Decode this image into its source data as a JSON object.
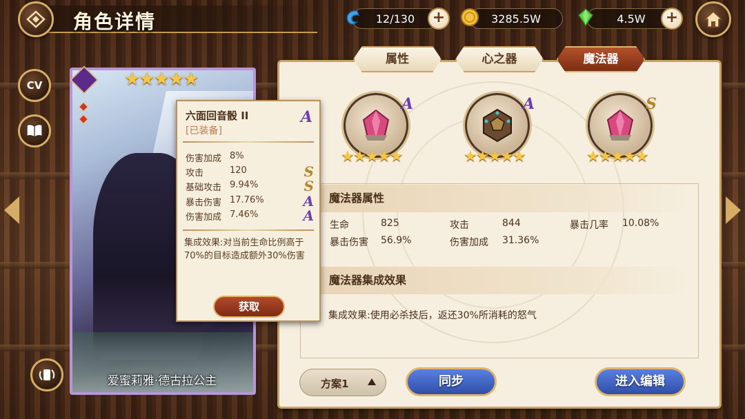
{
  "header": {
    "title": "角色详情",
    "resources": [
      {
        "name": "stamina",
        "icon": "shrimp-icon",
        "value": "12/130"
      },
      {
        "name": "gold",
        "icon": "gold-coin-icon",
        "value": "3285.5W"
      },
      {
        "name": "gems",
        "icon": "green-crystal-icon",
        "value": "4.5W"
      }
    ]
  },
  "side_buttons": {
    "cv": "CV"
  },
  "card": {
    "name": "爱蜜莉雅·德古拉公主",
    "stars": "★★★★★",
    "star_count": 5
  },
  "tooltip": {
    "item_name": "六面回音骰 II",
    "grade": "A",
    "status": "[已装备]",
    "stats": [
      {
        "label": "伤害加成",
        "value": "8%",
        "grade": ""
      },
      {
        "label": "攻击",
        "value": "120",
        "grade": "S"
      },
      {
        "label": "基础攻击",
        "value": "9.94%",
        "grade": "S"
      },
      {
        "label": "暴击伤害",
        "value": "17.76%",
        "grade": "A"
      },
      {
        "label": "伤害加成",
        "value": "7.46%",
        "grade": "A"
      }
    ],
    "set_effect": "集成效果:对当前生命比例高于70%的目标造成额外30%伤害",
    "acquire_button": "获取"
  },
  "tabs": [
    {
      "label": "属性",
      "active": false
    },
    {
      "label": "心之器",
      "active": false
    },
    {
      "label": "魔法器",
      "active": true
    }
  ],
  "gear_slots": [
    {
      "icon": "pink-crystal-icon",
      "grade": "A",
      "stars": "★★★★★"
    },
    {
      "icon": "d12-dice-icon",
      "grade": "A",
      "stars": "★★★★★"
    },
    {
      "icon": "pink-crystal-icon",
      "grade": "S",
      "stars": "★★★★★"
    }
  ],
  "attributes": {
    "section_title": "魔法器属性",
    "items": [
      {
        "label": "生命",
        "value": "825"
      },
      {
        "label": "攻击",
        "value": "844"
      },
      {
        "label": "暴击几率",
        "value": "10.08%"
      },
      {
        "label": "暴击伤害",
        "value": "56.9%"
      },
      {
        "label": "伤害加成",
        "value": "31.36%"
      }
    ]
  },
  "set_effect": {
    "section_title": "魔法器集成效果",
    "text": "集成效果:使用必杀技后，返还30%所消耗的怒气"
  },
  "footer": {
    "plan_label": "方案1",
    "sync_button": "同步",
    "edit_button": "进入编辑"
  },
  "colors": {
    "grade_a": "#6a3fb0",
    "grade_s": "#b8862a",
    "accent_red": "#9a3a1c",
    "blue_button": "#3a5cc0"
  }
}
